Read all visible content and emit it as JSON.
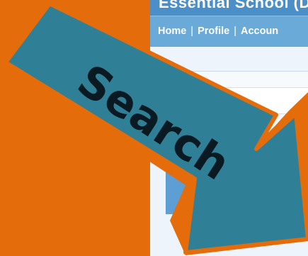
{
  "site": {
    "title": "Essential School (De",
    "nav": {
      "items": [
        {
          "label": "Home"
        },
        {
          "label": "Profile"
        },
        {
          "label": "Accoun"
        }
      ],
      "separator": "|"
    }
  },
  "overlay": {
    "arrow_label": "Search",
    "arrow_fill": "#2f8096",
    "arrow_border": "#e46c0a",
    "background": "#e46c0a"
  }
}
